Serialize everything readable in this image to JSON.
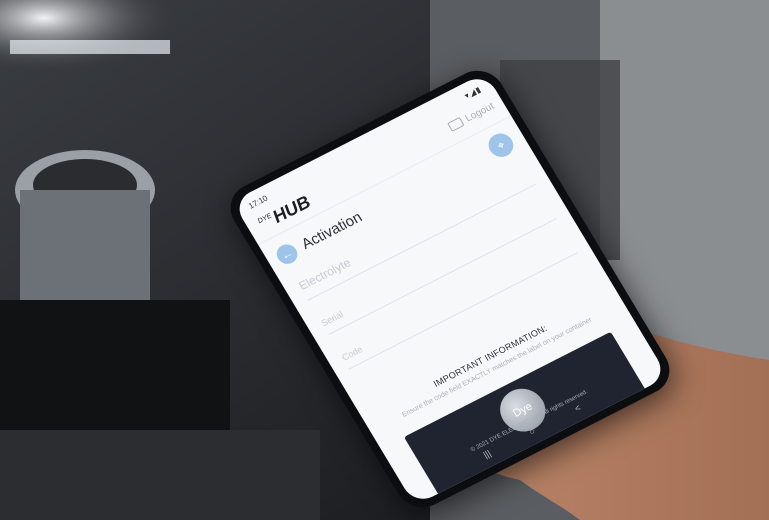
{
  "status": {
    "time": "17:10",
    "icons": "▾◢▮"
  },
  "app": {
    "logo_small": "DYE",
    "logo_text": "HUB",
    "logout": "Logout"
  },
  "activation": {
    "title": "Activation",
    "back_icon": "arrow-left-icon",
    "scan_icon": "scan-icon",
    "product": "Electrolyte",
    "serial_label": "Serial",
    "code_label": "Code"
  },
  "info": {
    "title": "IMPORTANT INFORMATION:",
    "text": "Ensure the code field EXACTLY matches the label on your container",
    "photo_brand": "Dye",
    "footer": "© 2021 DYE ELECTRIC LLC. All rights reserved."
  },
  "navbar": {
    "left": "|||",
    "mid": "○",
    "right": "<"
  },
  "colors": {
    "accent": "#9fc4ea",
    "screen": "#f7f8fa",
    "phone": "#0c0d10"
  }
}
